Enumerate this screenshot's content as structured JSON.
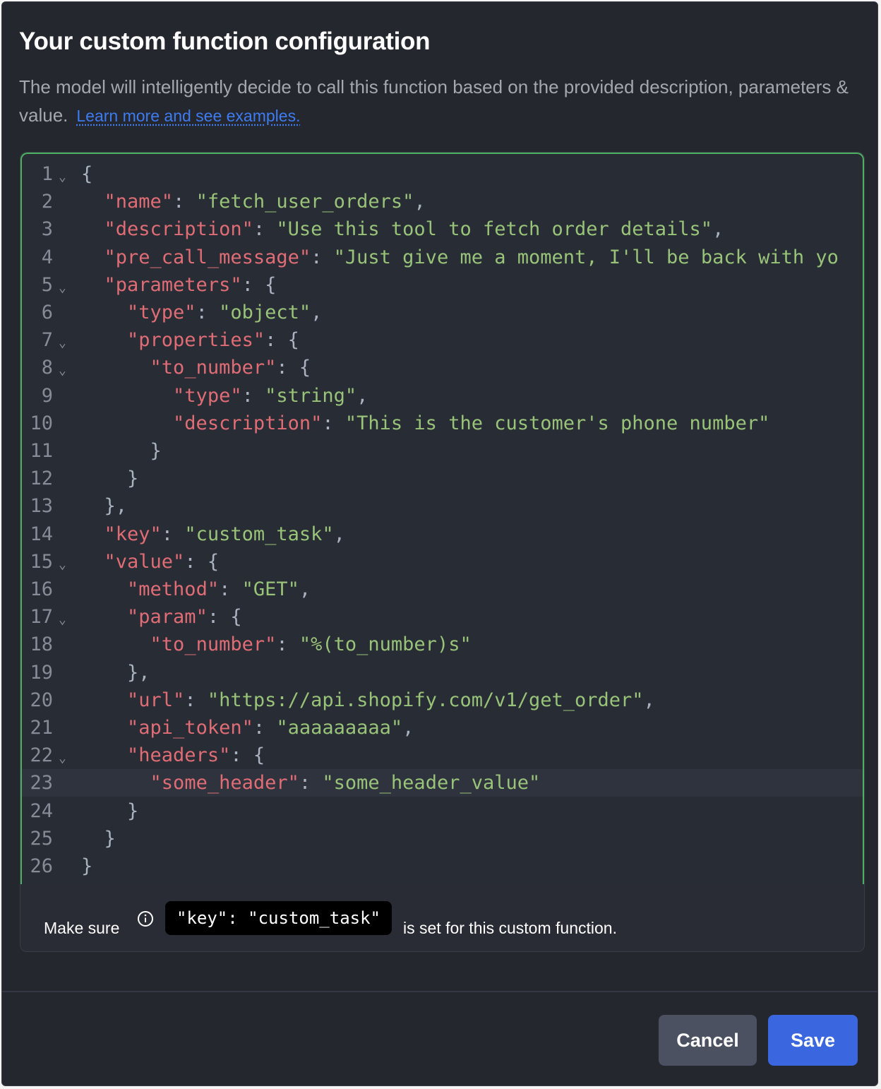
{
  "dialog": {
    "title": "Your custom function configuration",
    "description": "The model will intelligently decide to call this function based on the provided description, parameters & value.",
    "learn_more_link": "Learn more and see examples."
  },
  "editor": {
    "active_line": 23,
    "folded_lines": [
      1,
      5,
      7,
      8,
      15,
      17,
      22
    ],
    "lines": [
      "{",
      "  \"name\": \"fetch_user_orders\",",
      "  \"description\": \"Use this tool to fetch order details\",",
      "  \"pre_call_message\": \"Just give me a moment, I'll be back with yo",
      "  \"parameters\": {",
      "    \"type\": \"object\",",
      "    \"properties\": {",
      "      \"to_number\": {",
      "        \"type\": \"string\",",
      "        \"description\": \"This is the customer's phone number\"",
      "      }",
      "    }",
      "  },",
      "  \"key\": \"custom_task\",",
      "  \"value\": {",
      "    \"method\": \"GET\",",
      "    \"param\": {",
      "      \"to_number\": \"%(to_number)s\"",
      "    },",
      "    \"url\": \"https://api.shopify.com/v1/get_order\",",
      "    \"api_token\": \"aaaaaaaaa\",",
      "    \"headers\": {",
      "      \"some_header\": \"some_header_value\"",
      "    }",
      "  }",
      "}"
    ]
  },
  "notice": {
    "prefix": "Make sure",
    "key_chip": "\"key\": \"custom_task\"",
    "suffix": "is set for this custom function."
  },
  "footer": {
    "cancel_label": "Cancel",
    "save_label": "Save"
  },
  "colors": {
    "background": "#25272e",
    "editor_bg": "#282c34",
    "editor_border": "#4caf62",
    "json_key": "#e06c75",
    "json_string": "#98c379",
    "link": "#3d7bf0",
    "save_button": "#3a67e0",
    "cancel_button": "#4b5160"
  }
}
